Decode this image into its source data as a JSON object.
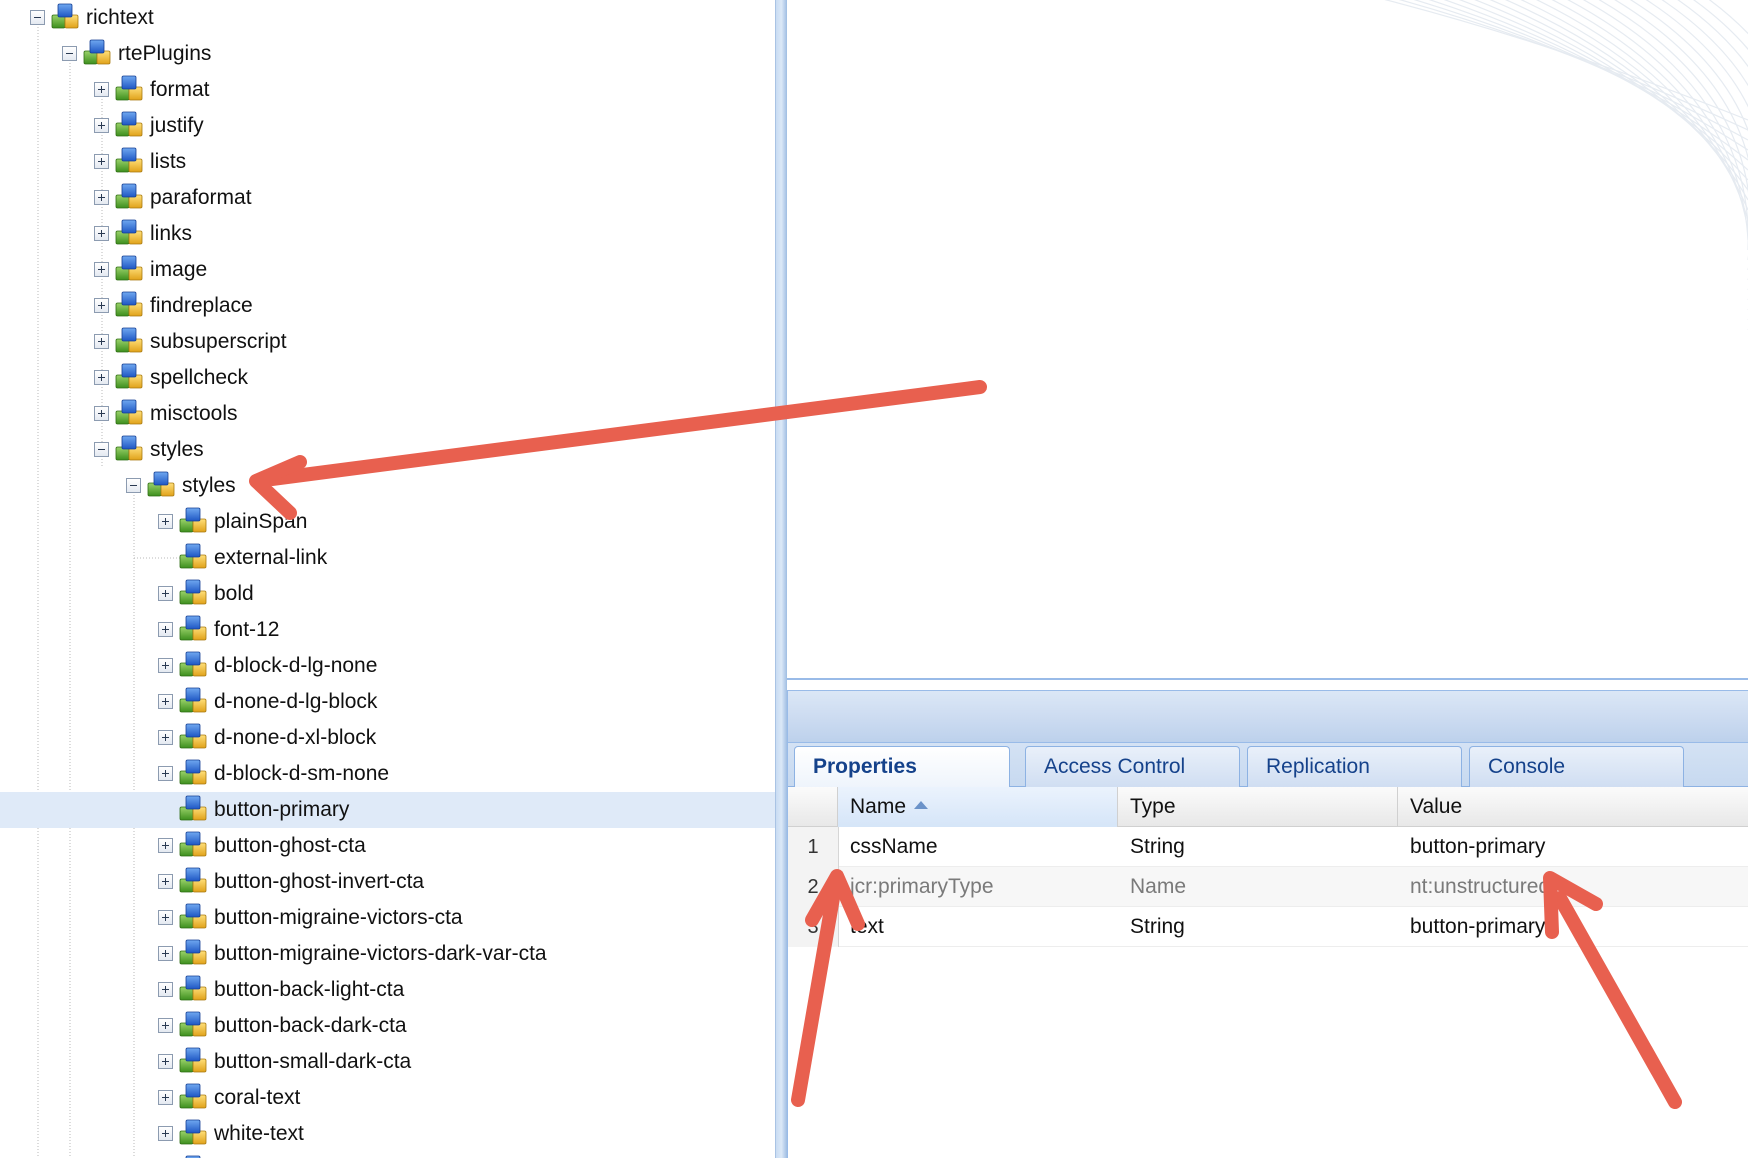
{
  "tree": {
    "nodes": [
      {
        "label": "richtext",
        "depth": 0,
        "toggle": "minus",
        "selected": false
      },
      {
        "label": "rtePlugins",
        "depth": 1,
        "toggle": "minus",
        "selected": false
      },
      {
        "label": "format",
        "depth": 2,
        "toggle": "plus",
        "selected": false
      },
      {
        "label": "justify",
        "depth": 2,
        "toggle": "plus",
        "selected": false
      },
      {
        "label": "lists",
        "depth": 2,
        "toggle": "plus",
        "selected": false
      },
      {
        "label": "paraformat",
        "depth": 2,
        "toggle": "plus",
        "selected": false
      },
      {
        "label": "links",
        "depth": 2,
        "toggle": "plus",
        "selected": false
      },
      {
        "label": "image",
        "depth": 2,
        "toggle": "plus",
        "selected": false
      },
      {
        "label": "findreplace",
        "depth": 2,
        "toggle": "plus",
        "selected": false
      },
      {
        "label": "subsuperscript",
        "depth": 2,
        "toggle": "plus",
        "selected": false
      },
      {
        "label": "spellcheck",
        "depth": 2,
        "toggle": "plus",
        "selected": false
      },
      {
        "label": "misctools",
        "depth": 2,
        "toggle": "plus",
        "selected": false
      },
      {
        "label": "styles",
        "depth": 2,
        "toggle": "minus",
        "selected": false
      },
      {
        "label": "styles",
        "depth": 3,
        "toggle": "minus",
        "selected": false
      },
      {
        "label": "plainSpan",
        "depth": 4,
        "toggle": "plus",
        "selected": false
      },
      {
        "label": "external-link",
        "depth": 4,
        "toggle": "none",
        "selected": false
      },
      {
        "label": "bold",
        "depth": 4,
        "toggle": "plus",
        "selected": false
      },
      {
        "label": "font-12",
        "depth": 4,
        "toggle": "plus",
        "selected": false
      },
      {
        "label": "d-block-d-lg-none",
        "depth": 4,
        "toggle": "plus",
        "selected": false
      },
      {
        "label": "d-none-d-lg-block",
        "depth": 4,
        "toggle": "plus",
        "selected": false
      },
      {
        "label": "d-none-d-xl-block",
        "depth": 4,
        "toggle": "plus",
        "selected": false
      },
      {
        "label": "d-block-d-sm-none",
        "depth": 4,
        "toggle": "plus",
        "selected": false
      },
      {
        "label": "button-primary",
        "depth": 4,
        "toggle": "none",
        "selected": true
      },
      {
        "label": "button-ghost-cta",
        "depth": 4,
        "toggle": "plus",
        "selected": false
      },
      {
        "label": "button-ghost-invert-cta",
        "depth": 4,
        "toggle": "plus",
        "selected": false
      },
      {
        "label": "button-migraine-victors-cta",
        "depth": 4,
        "toggle": "plus",
        "selected": false
      },
      {
        "label": "button-migraine-victors-dark-var-cta",
        "depth": 4,
        "toggle": "plus",
        "selected": false
      },
      {
        "label": "button-back-light-cta",
        "depth": 4,
        "toggle": "plus",
        "selected": false
      },
      {
        "label": "button-back-dark-cta",
        "depth": 4,
        "toggle": "plus",
        "selected": false
      },
      {
        "label": "button-small-dark-cta",
        "depth": 4,
        "toggle": "plus",
        "selected": false
      },
      {
        "label": "coral-text",
        "depth": 4,
        "toggle": "plus",
        "selected": false
      },
      {
        "label": "white-text",
        "depth": 4,
        "toggle": "plus",
        "selected": false
      },
      {
        "label": "",
        "depth": 4,
        "toggle": "none",
        "selected": false
      }
    ]
  },
  "tabs": [
    {
      "label": "Properties",
      "active": true
    },
    {
      "label": "Access Control",
      "active": false
    },
    {
      "label": "Replication",
      "active": false
    },
    {
      "label": "Console",
      "active": false
    }
  ],
  "grid": {
    "columns": [
      "Name",
      "Type",
      "Value"
    ],
    "sorted_column": "Name",
    "rows": [
      {
        "num": "1",
        "name": "cssName",
        "type": "String",
        "value": "button-primary",
        "muted": false
      },
      {
        "num": "2",
        "name": "jcr:primaryType",
        "type": "Name",
        "value": "nt:unstructured",
        "muted": true
      },
      {
        "num": "3",
        "name": "text",
        "type": "String",
        "value": "button-primary",
        "muted": false
      }
    ]
  },
  "colors": {
    "selection": "#dfeaf8",
    "tab_text": "#15428b",
    "annotation_arrow": "#e8604f"
  },
  "icons": {
    "tree_node": "node-cubes-icon",
    "expand": "expand-plus-icon",
    "collapse": "collapse-minus-icon",
    "sort": "sort-ascending-icon"
  }
}
